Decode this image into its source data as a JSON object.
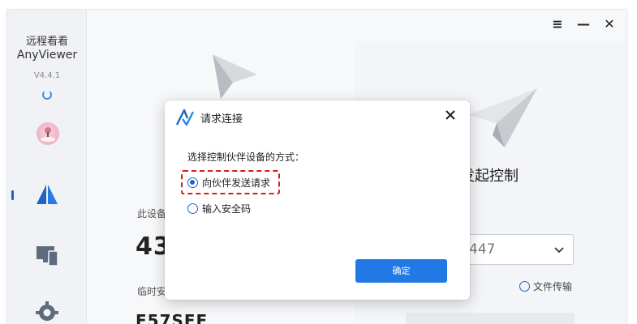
{
  "app": {
    "name_cn": "远程看看",
    "name_en": "AnyViewer",
    "version": "V4.4.1"
  },
  "window_controls": {
    "menu_glyph": "≡",
    "minimize_glyph": "—",
    "close_glyph": "✕"
  },
  "sidebar": {
    "items": [
      {
        "name": "remote-control",
        "icon": "anyviewer-logo-icon",
        "active": true
      },
      {
        "name": "devices",
        "icon": "devices-icon",
        "active": false
      },
      {
        "name": "settings",
        "icon": "gear-icon",
        "active": false
      }
    ]
  },
  "left_panel": {
    "this_device_label": "此设备",
    "device_id_partial": "43",
    "temp_code_label": "临时安",
    "temp_code_partial": "F57SFF"
  },
  "right_panel": {
    "title_partial": "发起控制",
    "device_select_partial": "447",
    "file_transfer_option": "文件传输"
  },
  "dialog": {
    "title": "请求连接",
    "prompt": "选择控制伙伴设备的方式：",
    "options": [
      {
        "label": "向伙伴发送请求",
        "checked": true
      },
      {
        "label": "输入安全码",
        "checked": false
      }
    ],
    "confirm_label": "确定"
  },
  "colors": {
    "accent": "#2179e6",
    "brand_dark": "#1f64c6",
    "highlight": "#d61b1b"
  }
}
